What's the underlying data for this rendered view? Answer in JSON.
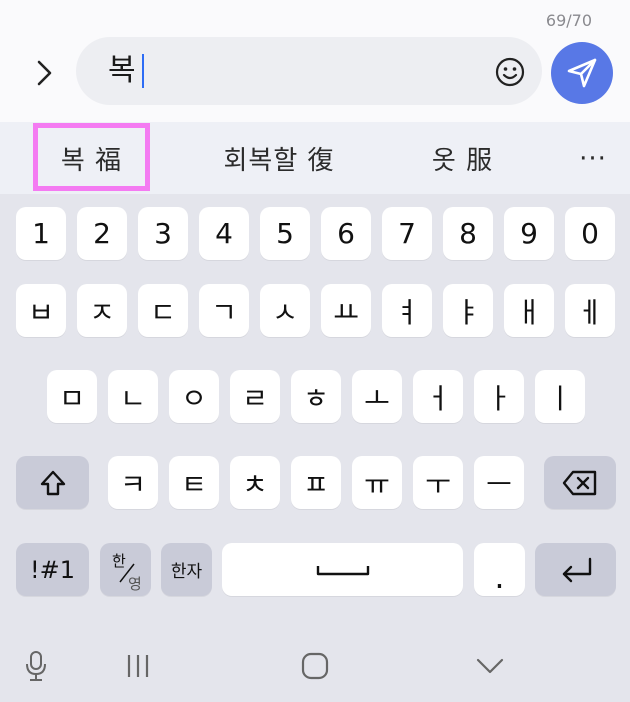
{
  "compose": {
    "char_counter": "69/70",
    "input_text": "복",
    "expand_icon": "chevron-right-icon",
    "emoji_icon": "smiley-icon",
    "send_icon": "send-icon",
    "send_color": "#5878e6"
  },
  "suggestions": {
    "items": [
      "복 福",
      "회복할 復",
      "옷 服"
    ],
    "more_label": "···",
    "highlight_color": "#f47bf2"
  },
  "keyboard": {
    "row_numbers": [
      "1",
      "2",
      "3",
      "4",
      "5",
      "6",
      "7",
      "8",
      "9",
      "0"
    ],
    "row1": [
      "ㅂ",
      "ㅈ",
      "ㄷ",
      "ㄱ",
      "ㅅ",
      "ㅛ",
      "ㅕ",
      "ㅑ",
      "ㅐ",
      "ㅔ"
    ],
    "row2": [
      "ㅁ",
      "ㄴ",
      "ㅇ",
      "ㄹ",
      "ㅎ",
      "ㅗ",
      "ㅓ",
      "ㅏ",
      "ㅣ"
    ],
    "row3": [
      "ㅋ",
      "ㅌ",
      "ㅊ",
      "ㅍ",
      "ㅠ",
      "ㅜ",
      "ㅡ"
    ],
    "symbols_label": "!#1",
    "han_label": "한",
    "yeong_label": "영",
    "hanja_label": "한자",
    "period_label": ".",
    "shift_icon": "shift-arrow-icon",
    "backspace_icon": "backspace-icon",
    "space_icon": "space-bar-icon",
    "enter_icon": "enter-arrow-icon"
  },
  "nav": {
    "voice_icon": "microphone-icon",
    "recents_icon": "recents-icon",
    "home_icon": "home-icon",
    "back_icon": "chevron-down-icon"
  }
}
